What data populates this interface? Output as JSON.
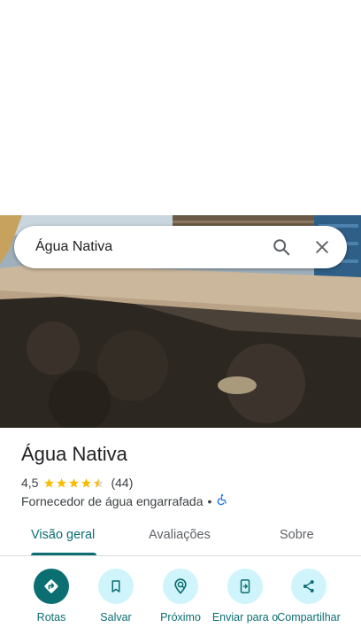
{
  "search": {
    "query": "Água Nativa",
    "search_icon": "search-icon",
    "close_icon": "close-icon"
  },
  "place": {
    "name": "Água Nativa",
    "rating": "4,5",
    "stars": 4.5,
    "reviews_count": "(44)",
    "category": "Fornecedor de água engarrafada",
    "separator": "•",
    "accessibility_icon": "wheelchair-icon"
  },
  "tabs": [
    {
      "label": "Visão geral",
      "active": true
    },
    {
      "label": "Avaliações",
      "active": false
    },
    {
      "label": "Sobre",
      "active": false
    }
  ],
  "actions": [
    {
      "label": "Rotas",
      "icon": "directions-icon"
    },
    {
      "label": "Salvar",
      "icon": "bookmark-icon"
    },
    {
      "label": "Próximo",
      "icon": "nearby-icon"
    },
    {
      "label": "Enviar para o",
      "icon": "send-to-phone-icon"
    },
    {
      "label": "Compartilhar",
      "icon": "share-icon"
    }
  ],
  "colors": {
    "accent": "#0b6e71",
    "accent_light": "#cff4fb",
    "star": "#fbbc04",
    "accessibility": "#1a73e8"
  }
}
